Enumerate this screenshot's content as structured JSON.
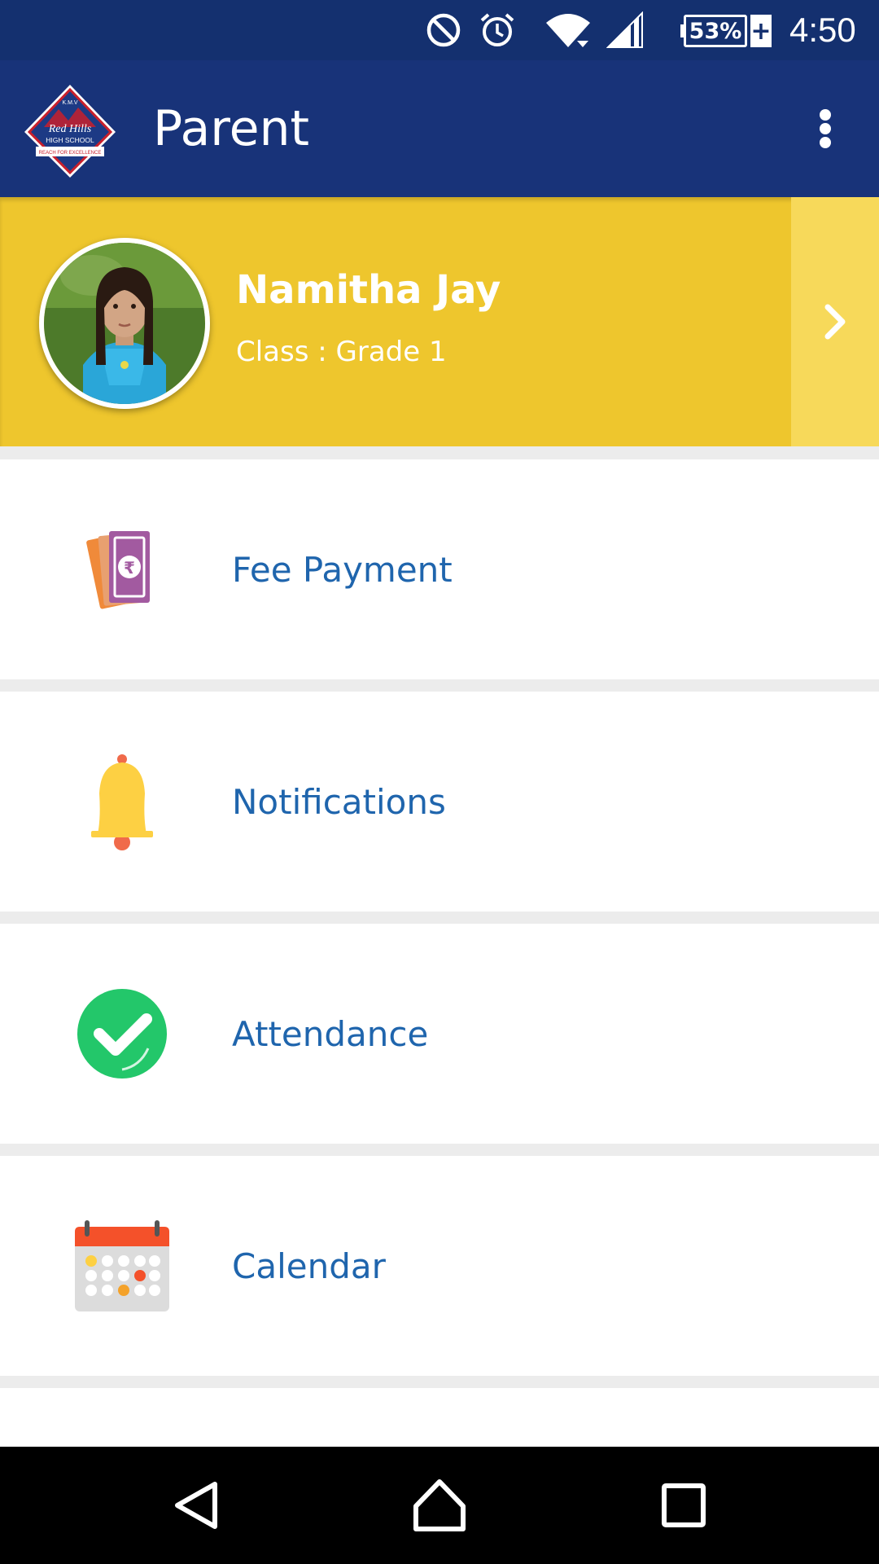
{
  "status_bar": {
    "battery_percent": "53%",
    "battery_plus": "+",
    "time": "4:50",
    "icons": [
      "do-not-disturb-icon",
      "alarm-icon",
      "wifi-icon",
      "cell-signal-icon",
      "battery-icon"
    ]
  },
  "app_bar": {
    "title": "Parent",
    "logo": {
      "top_text": "K.M.V",
      "name": "Red Hills",
      "subtitle": "HIGH SCHOOL",
      "tagline": "REACH FOR EXCELLENCE"
    },
    "menu_icon": "more-vert-icon"
  },
  "student": {
    "name": "Namitha Jay",
    "class": "Class : Grade 1",
    "arrow_icon": "chevron-right-icon"
  },
  "menu": {
    "items": [
      {
        "label": "Fee Payment",
        "icon": "rupee-money-icon"
      },
      {
        "label": "Notifications",
        "icon": "bell-icon"
      },
      {
        "label": "Attendance",
        "icon": "check-circle-icon"
      },
      {
        "label": "Calendar",
        "icon": "calendar-icon"
      }
    ]
  },
  "colors": {
    "status_bar": "#14306f",
    "app_bar": "#183379",
    "student_card": "#eec62d",
    "student_arrow_bg": "#f7d95a",
    "menu_label": "#1f65ad",
    "divider": "#ececec"
  },
  "nav_bar": {
    "icons": [
      "back-icon",
      "home-icon",
      "recents-icon"
    ]
  }
}
